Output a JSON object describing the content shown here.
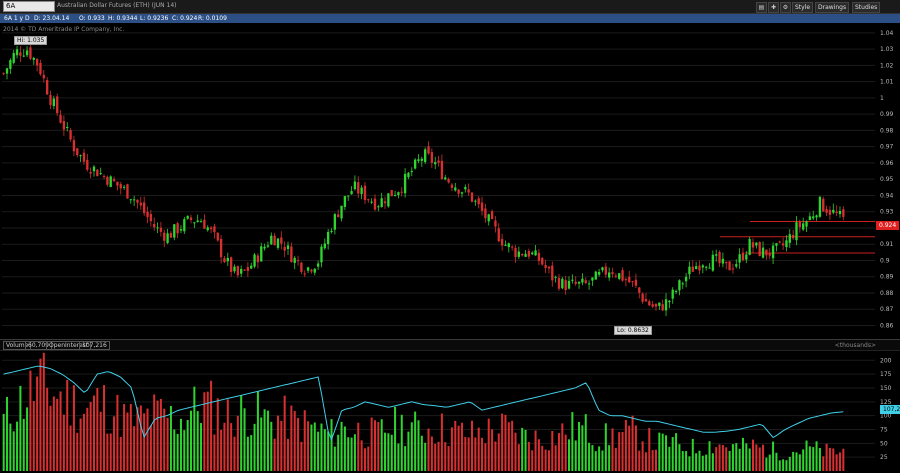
{
  "toolbar": {
    "symbol": "6A",
    "title": "Australian Dollar Futures (ETH) (JUN 14)",
    "style_label": "Style",
    "drawings_label": "Drawings",
    "studies_label": "Studies"
  },
  "info": {
    "period": "6A 1 y D",
    "date": "D: 23.04.14",
    "open": "O: 0.933",
    "high": "H: 0.9344",
    "low": "L: 0.9236",
    "close": "C: 0.924",
    "range": "R: 0.0109"
  },
  "copyright": "2014 © TD Ameritrade IP Company, Inc.",
  "price_labels": {
    "high": "Hi: 1.035",
    "low": "Lo: 0.8632",
    "last": "0.924"
  },
  "lower": {
    "volume_label": "Volume",
    "volume_value": "60,709",
    "oi_label": "OpenInterest",
    "oi_value": "107,216",
    "units": "<thousands>",
    "oi_last": "107,216"
  },
  "colors": {
    "up": "#2fd42f",
    "down": "#d83030",
    "oi_line": "#3fd0e8",
    "info_bar": "#2c4f86"
  },
  "chart_data": {
    "type": "candlestick",
    "price_axis": {
      "ticks": [
        "1.04",
        "1.03",
        "1.02",
        "1.01",
        "1",
        "0.99",
        "0.98",
        "0.97",
        "0.96",
        "0.95",
        "0.94",
        "0.93",
        "0.92",
        "0.91",
        "0.9",
        "0.89",
        "0.88",
        "0.87",
        "0.86"
      ],
      "ylim": [
        0.856,
        1.043
      ]
    },
    "volume_axis": {
      "ticks": [
        "200",
        "175",
        "150",
        "125",
        "100",
        "75",
        "50",
        "25"
      ],
      "ylim": [
        0,
        215
      ]
    },
    "horizontal_levels": [
      0.924,
      0.9146,
      0.9046
    ],
    "close_path": [
      1.015,
      1.028,
      1.03,
      1.02,
      1.0,
      0.985,
      0.97,
      0.96,
      0.955,
      0.95,
      0.945,
      0.94,
      0.93,
      0.92,
      0.915,
      0.92,
      0.925,
      0.925,
      0.915,
      0.9,
      0.89,
      0.895,
      0.905,
      0.915,
      0.91,
      0.9,
      0.895,
      0.9,
      0.92,
      0.935,
      0.945,
      0.94,
      0.935,
      0.94,
      0.945,
      0.955,
      0.965,
      0.96,
      0.95,
      0.945,
      0.94,
      0.93,
      0.92,
      0.91,
      0.905,
      0.905,
      0.9,
      0.89,
      0.885,
      0.885,
      0.885,
      0.89,
      0.895,
      0.89,
      0.885,
      0.875,
      0.87,
      0.875,
      0.885,
      0.895,
      0.9,
      0.9,
      0.895,
      0.9,
      0.91,
      0.905,
      0.905,
      0.91,
      0.92,
      0.925,
      0.935,
      0.93,
      0.925
    ],
    "volume_path": [
      110,
      140,
      165,
      190,
      175,
      160,
      150,
      130,
      150,
      140,
      120,
      110,
      115,
      125,
      120,
      110,
      130,
      150,
      140,
      120,
      125,
      130,
      120,
      110,
      115,
      105,
      100,
      90,
      80,
      95,
      90,
      85,
      80,
      95,
      100,
      95,
      90,
      95,
      90,
      85,
      80,
      85,
      90,
      95,
      80,
      75,
      70,
      75,
      85,
      95,
      90,
      70,
      75,
      80,
      85,
      70,
      60,
      65,
      55,
      50,
      55,
      60,
      55,
      50,
      55,
      50,
      45,
      40,
      45,
      50,
      45,
      40,
      45
    ],
    "oi_path": [
      175,
      180,
      185,
      190,
      185,
      175,
      160,
      140,
      175,
      180,
      170,
      150,
      60,
      95,
      100,
      110,
      115,
      120,
      125,
      130,
      135,
      140,
      145,
      150,
      155,
      160,
      165,
      170,
      50,
      110,
      115,
      125,
      120,
      115,
      120,
      125,
      120,
      118,
      115,
      120,
      125,
      110,
      115,
      120,
      125,
      130,
      135,
      140,
      145,
      150,
      160,
      110,
      100,
      100,
      95,
      90,
      90,
      85,
      80,
      75,
      70,
      70,
      72,
      75,
      80,
      85,
      60,
      75,
      85,
      95,
      100,
      105,
      107
    ]
  }
}
